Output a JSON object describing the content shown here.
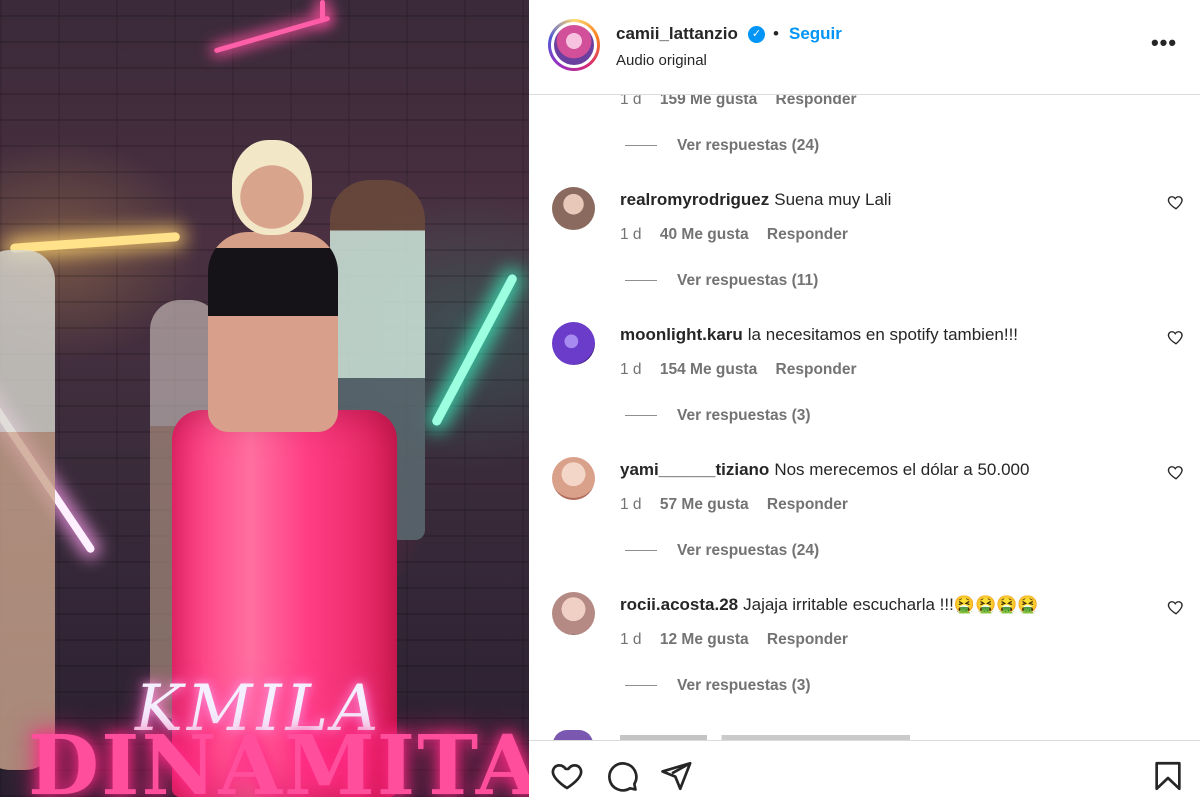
{
  "media": {
    "logo_line1": "KMILA",
    "logo_line2": "DINAMITA"
  },
  "header": {
    "username": "camii_lattanzio",
    "verified_icon": "verified-badge-icon",
    "separator": "•",
    "follow_label": "Seguir",
    "subtitle": "Audio original",
    "more_icon": "more-options-icon",
    "more_glyph": "•••"
  },
  "top_partial": {
    "time": "1 d",
    "likes": "159 Me gusta",
    "reply": "Responder",
    "view_replies": "Ver respuestas (24)"
  },
  "comments": [
    {
      "username": "realromyrodriguez",
      "text": "Suena muy Lali",
      "time": "1 d",
      "likes": "40 Me gusta",
      "reply": "Responder",
      "view_replies": "Ver respuestas (11)",
      "avatar_color": "#8a6a5e"
    },
    {
      "username": "moonlight.karu",
      "text": "la necesitamos en spotify tambien!!!",
      "time": "1 d",
      "likes": "154 Me gusta",
      "reply": "Responder",
      "view_replies": "Ver respuestas (3)",
      "avatar_color": "#6a3cc9"
    },
    {
      "username": "yami______tiziano",
      "text": "Nos merecemos el dólar a 50.000",
      "time": "1 d",
      "likes": "57 Me gusta",
      "reply": "Responder",
      "view_replies": "Ver respuestas (24)",
      "avatar_color": "#d9a08a"
    },
    {
      "username": "rocii.acosta.28",
      "text": "Jajaja irritable escucharla !!!🤮🤮🤮🤮",
      "time": "1 d",
      "likes": "12 Me gusta",
      "reply": "Responder",
      "view_replies": "Ver respuestas (3)",
      "avatar_color": "#b58a84"
    }
  ],
  "footer": {
    "like_icon": "heart-icon",
    "comment_icon": "comment-icon",
    "share_icon": "share-icon",
    "save_icon": "bookmark-icon"
  },
  "colors": {
    "link_blue": "#0095f6",
    "muted_text": "#737373",
    "text": "#262626",
    "border": "#dbdbdb"
  }
}
